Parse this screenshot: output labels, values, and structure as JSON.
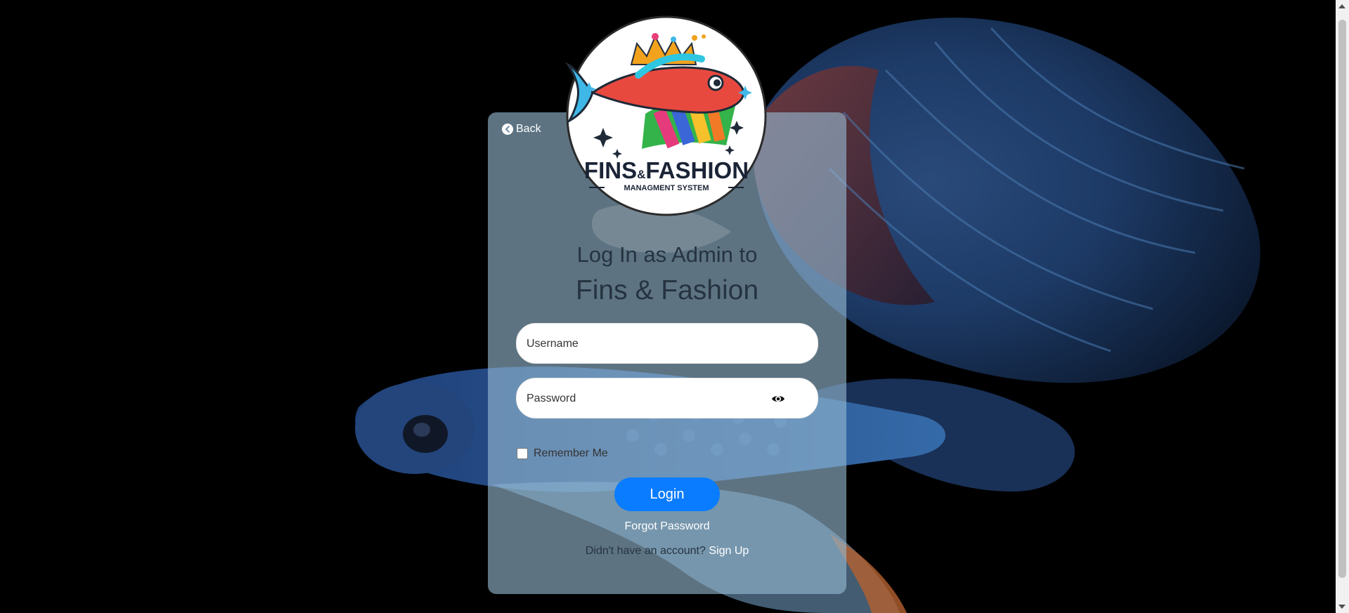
{
  "back": {
    "label": "Back"
  },
  "logo": {
    "brand": "FINS&FASHION",
    "brand_line1": "FINS",
    "brand_amp": "&",
    "brand_line2": "FASHION",
    "tagline": "MANAGMENT SYSTEM"
  },
  "title": {
    "line1": "Log In as Admin to",
    "line2": "Fins & Fashion"
  },
  "form": {
    "username_placeholder": "Username",
    "username_value": "",
    "password_placeholder": "Password",
    "password_value": "",
    "remember_label": "Remember Me",
    "remember_checked": false,
    "login_label": "Login",
    "forgot_label": "Forgot Password",
    "signup_prompt": "Didn't have an account? ",
    "signup_label": "Sign Up"
  },
  "colors": {
    "primary_button": "#0a7cff",
    "card_tint": "#96b9d2",
    "title_text": "#263340"
  },
  "icons": {
    "back": "chevron-left-circle-icon",
    "password_toggle": "eye-icon"
  }
}
